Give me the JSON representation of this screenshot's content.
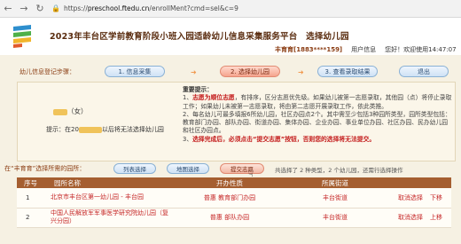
{
  "browser": {
    "url_scheme": "https://",
    "url_host": "preschool.ftedu.cn",
    "url_path": "/enrollMent?cmd=sel&c=9"
  },
  "header": {
    "title": "2023年丰台区学前教育阶段小班入园适龄幼儿信息采集服务平台　选择幼儿园",
    "user_name": "丰育育[1883****159]",
    "user_center": "用户信息",
    "welcome": "您好！欢迎使用14:47:07"
  },
  "steps": {
    "label": "幼儿信息登记步骤：",
    "items": [
      {
        "label": "1. 信息采集"
      },
      {
        "label": "2. 选择幼儿园"
      },
      {
        "label": "3. 查看录取结果"
      },
      {
        "label": "退出"
      }
    ]
  },
  "child": {
    "name_suffix": "（女）",
    "age_prefix": "提示：在20",
    "age_suffix": "以后将无法选择幼儿园"
  },
  "notice": {
    "title": "重要提示：",
    "lines": [
      {
        "num": "1、",
        "red": "志愿为顺位志愿",
        "text": "，有排序，区分志愿优先级。如果幼儿被第一志愿录取，其他园（点）将停止录取工作；如果幼儿未被第一志愿录取，将由第二志愿开展录取工作，依此类推。"
      },
      {
        "num": "2、",
        "red": "",
        "text": "每名幼儿可最多填报6所幼儿园，社区办园点2个。其中需至少包括3种园所类型，园所类型包括：教育部门办园、部队办园、街道办园、集体办园、企业办园、事业单位办园、社区办园、民办幼儿园和社区办园点。"
      },
      {
        "num": "3、",
        "red": "",
        "text": "选择完成后，必须点击“提交志愿”按钮，否则您的选择将无法提交。"
      }
    ]
  },
  "selection": {
    "hint": "在“丰育育”选择所需的园所：",
    "buttons": [
      {
        "label": "列表选择"
      },
      {
        "label": "地图选择"
      },
      {
        "label": "提交志愿"
      }
    ],
    "summary": "共选择了 2 种类型，2 个幼儿园，还需行选择操作"
  },
  "table": {
    "headers": [
      "序号",
      "园所名称",
      "开办性质",
      "所属街道",
      ""
    ],
    "rows": [
      {
        "idx": "1",
        "name": "北京市丰台区第一幼儿园 - 丰台园",
        "type": "普惠 教育部门办园",
        "street": "丰台街道",
        "ops": [
          "取消选择",
          "下移"
        ]
      },
      {
        "idx": "2",
        "name": "中国人民解放军军事医学研究院幼儿园（复兴分园）",
        "type": "普惠 部队办园",
        "street": "丰台街道",
        "ops": [
          "取消选择",
          "上移"
        ]
      }
    ]
  },
  "colors": {
    "accent_brown": "#a55e30",
    "link_red": "#c62828",
    "step_active": "#f5a48d"
  }
}
